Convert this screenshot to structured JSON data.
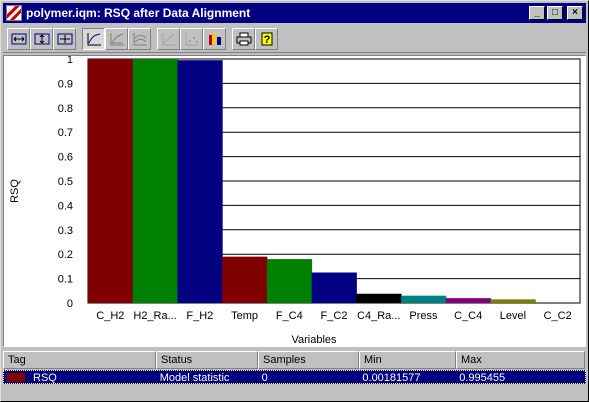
{
  "window": {
    "title": "polymer.iqm: RSQ after Data Alignment",
    "minimize": "_",
    "maximize": "□",
    "close": "×"
  },
  "toolbar": {
    "buttons": [
      {
        "icon": "zoom-horizontal-icon"
      },
      {
        "icon": "zoom-vertical-icon"
      },
      {
        "icon": "zoom-both-icon"
      },
      {
        "icon": "line-plot-icon",
        "pressed": true
      },
      {
        "icon": "area-plot-icon"
      },
      {
        "icon": "contour-plot-icon"
      },
      {
        "icon": "axis-plot-icon",
        "disabled": true
      },
      {
        "icon": "scatter-plot-icon",
        "disabled": true
      },
      {
        "icon": "bar-chart-icon"
      },
      {
        "icon": "print-icon"
      },
      {
        "icon": "help-icon"
      }
    ]
  },
  "chart_data": {
    "type": "bar",
    "xlabel": "Variables",
    "ylabel": "RSQ",
    "ylim": [
      0,
      1
    ],
    "yticks": [
      "0",
      "0.1",
      "0.2",
      "0.3",
      "0.4",
      "0.5",
      "0.6",
      "0.7",
      "0.8",
      "0.9",
      "1"
    ],
    "grid": true,
    "categories": [
      "C_H2",
      "H2_Ra...",
      "F_H2",
      "Temp",
      "F_C4",
      "F_C2",
      "C4_Ra...",
      "Press",
      "C_C4",
      "Level",
      "C_C2"
    ],
    "values": [
      1.0,
      1.0,
      0.995,
      0.19,
      0.18,
      0.125,
      0.038,
      0.03,
      0.02,
      0.015,
      0.002
    ],
    "colors": [
      "#800000",
      "#008000",
      "#000080",
      "#800000",
      "#008000",
      "#000080",
      "#000000",
      "#008080",
      "#800080",
      "#808000",
      "#000000"
    ]
  },
  "table": {
    "columns": [
      "Tag",
      "Status",
      "Samples",
      "Min",
      "Max"
    ],
    "rows": [
      {
        "tag": "RSQ",
        "status": "Model statistic",
        "samples": "0",
        "min": "0.00181577",
        "max": "0.995455",
        "color": "#800000"
      }
    ]
  }
}
